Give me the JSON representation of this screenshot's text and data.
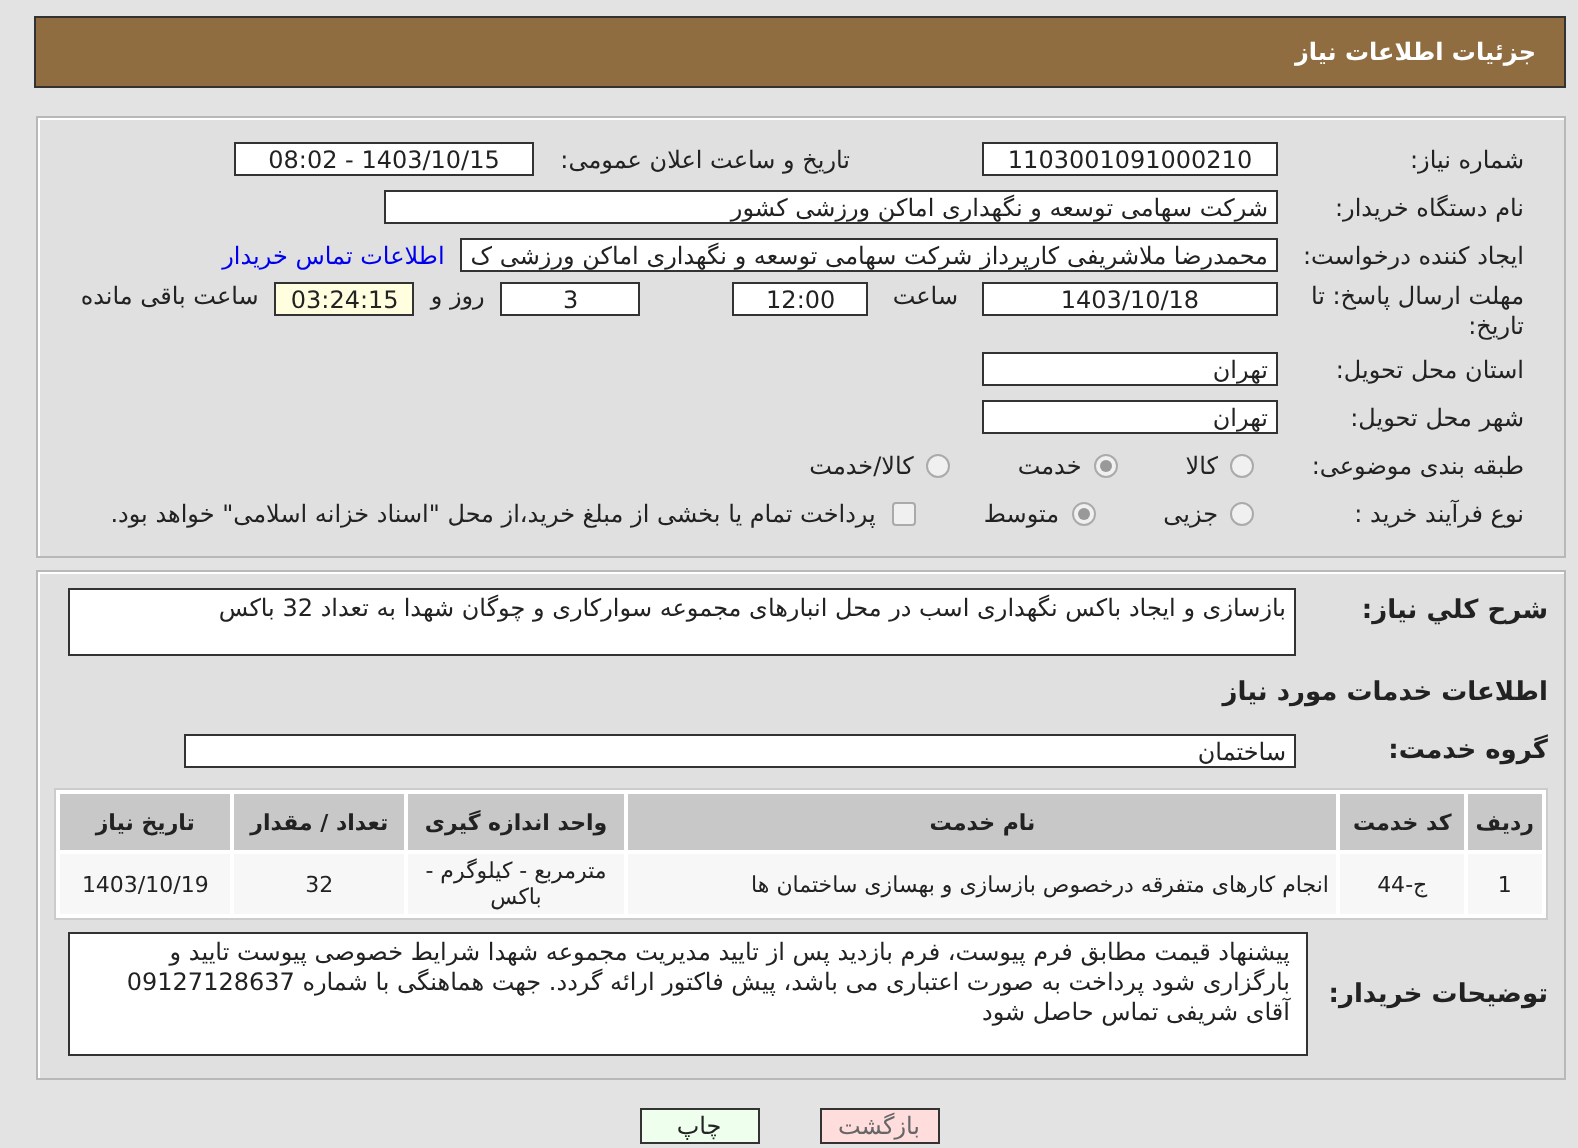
{
  "header": {
    "title": "جزئیات اطلاعات نیاز"
  },
  "fields": {
    "need_number_label": "شماره نیاز:",
    "need_number": "1103001091000210",
    "announce_label": "تاریخ و ساعت اعلان عمومی:",
    "announce": "1403/10/15 - 08:02",
    "buyer_label": "نام دستگاه خریدار:",
    "buyer": "شرکت سهامی توسعه و نگهداری اماکن ورزشی کشور",
    "creator_label": "ایجاد کننده درخواست:",
    "creator": "محمدرضا ملاشریفی کارپرداز شرکت سهامی توسعه و نگهداری اماکن ورزشی ک",
    "contact_link": "اطلاعات تماس خریدار",
    "deadline_label": "مهلت ارسال پاسخ: تا تاریخ:",
    "deadline_date": "1403/10/18",
    "time_label": "ساعت",
    "deadline_time": "12:00",
    "days": "3",
    "days_label": "روز و",
    "remaining": "03:24:15",
    "remaining_label": "ساعت باقی مانده",
    "province_label": "استان محل تحویل:",
    "province": "تهران",
    "city_label": "شهر محل تحویل:",
    "city": "تهران"
  },
  "classification": {
    "label": "طبقه بندی موضوعی:",
    "options": [
      {
        "label": "کالا",
        "selected": false
      },
      {
        "label": "خدمت",
        "selected": true
      },
      {
        "label": "کالا/خدمت",
        "selected": false
      }
    ]
  },
  "process": {
    "label": "نوع فرآیند خرید :",
    "options": [
      {
        "label": "جزیی",
        "selected": false
      },
      {
        "label": "متوسط",
        "selected": true
      }
    ],
    "payment_checked": false,
    "payment_text": "پرداخت تمام یا بخشی از مبلغ خرید،از محل \"اسناد خزانه اسلامی\" خواهد بود."
  },
  "description": {
    "label": "شرح کلي نیاز:",
    "value": "بازسازی و ایجاد باکس نگهداری اسب در محل انبارهای مجموعه سوارکاری و چوگان شهدا به تعداد 32 باکس"
  },
  "services": {
    "heading": "اطلاعات خدمات مورد نیاز",
    "group_label": "گروه خدمت:",
    "group": "ساختمان"
  },
  "table": {
    "columns": [
      "ردیف",
      "کد خدمت",
      "نام خدمت",
      "واحد اندازه گیری",
      "تعداد / مقدار",
      "تاریخ نیاز"
    ],
    "rows": [
      [
        "1",
        "ج-44",
        "انجام کارهای متفرقه درخصوص بازسازی و بهسازی ساختمان ها",
        "مترمربع - کیلوگرم - باکس",
        "32",
        "1403/10/19"
      ]
    ]
  },
  "notes": {
    "label": "توضیحات خریدار:",
    "value": "پیشنهاد قیمت مطابق فرم پیوست، فرم بازدید پس از تایید مدیریت مجموعه شهدا شرایط خصوصی پیوست تایید و بارگزاری شود پرداخت به صورت اعتباری می باشد، پیش فاکتور ارائه گردد. جهت هماهنگی با شماره 09127128637 آقای شریفی تماس حاصل شود"
  },
  "buttons": [
    {
      "label": "بازگشت",
      "kind": "back"
    },
    {
      "label": "چاپ",
      "kind": "print"
    }
  ]
}
